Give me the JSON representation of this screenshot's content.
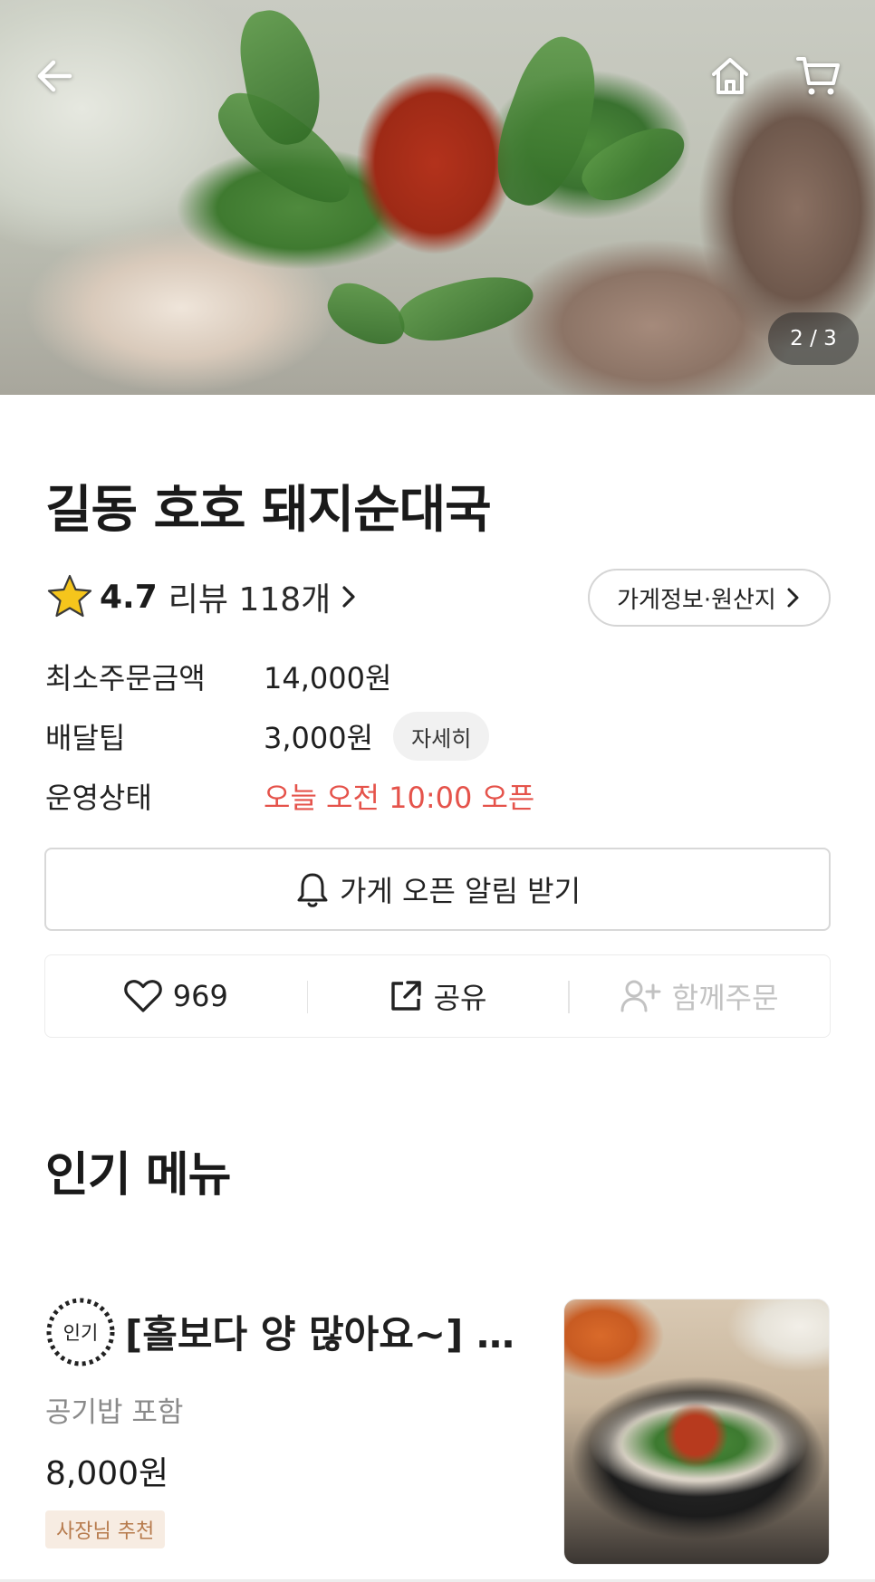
{
  "hero": {
    "pager": "2 / 3"
  },
  "store": {
    "name": "길동 호호 돼지순대국",
    "rating": "4.7",
    "review_label": "리뷰 118개",
    "info_button": "가게정보·원산지"
  },
  "info_rows": {
    "min_order_label": "최소주문금액",
    "min_order_value": "14,000원",
    "delivery_tip_label": "배달팁",
    "delivery_tip_value": "3,000원",
    "detail_chip": "자세히",
    "status_label": "운영상태",
    "status_value": "오늘 오전 10:00 오픈",
    "status_color": "#e5534b"
  },
  "notify_button": "가게 오픈 알림 받기",
  "actions": {
    "like_count": "969",
    "share_label": "공유",
    "group_order_label": "함께주문"
  },
  "popular": {
    "section_title": "인기 메뉴",
    "items": [
      {
        "badge": "인기",
        "name": "[홀보다 양 많아요~] 순대국",
        "description": "공기밥 포함",
        "price": "8,000원",
        "tag": "사장님 추천"
      }
    ]
  },
  "icons": [
    "back-arrow-icon",
    "home-icon",
    "cart-icon",
    "star-icon",
    "chevron-right-icon",
    "bell-icon",
    "heart-icon",
    "share-icon",
    "add-user-icon"
  ]
}
